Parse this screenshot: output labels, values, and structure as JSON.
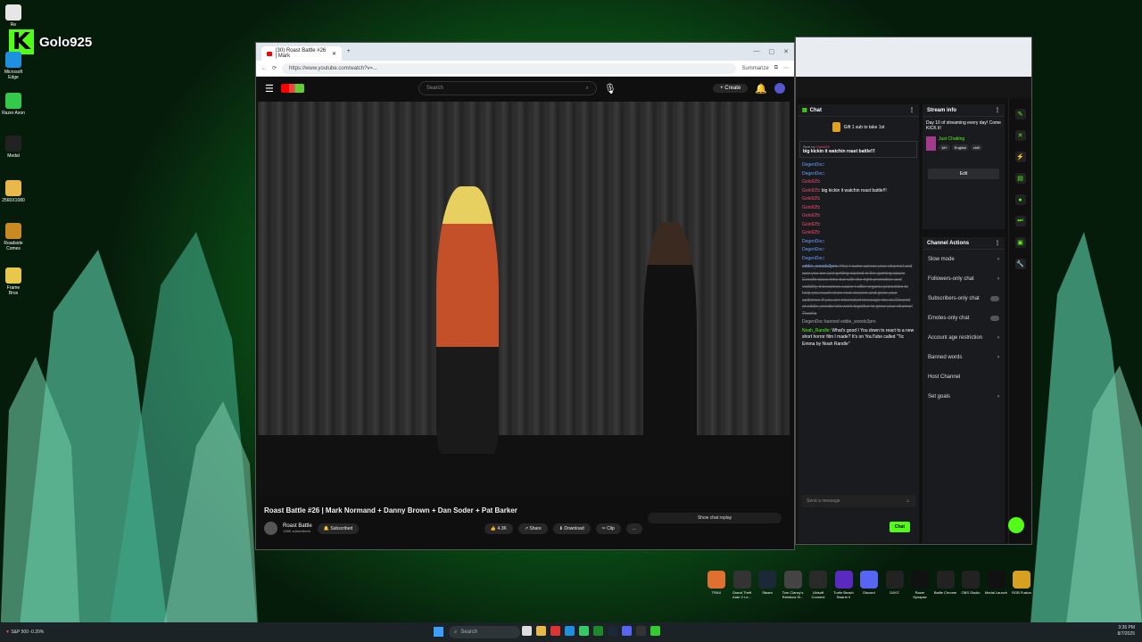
{
  "streamer": {
    "name": "Golo925",
    "logo_letter": "K"
  },
  "desktop_icons": [
    {
      "label": "Re",
      "color": "#e6e6e6"
    },
    {
      "label": "Microsoft Edge",
      "color": "#1f8fe0"
    },
    {
      "label": "Razer Axon",
      "color": "#34c94a"
    },
    {
      "label": "Medal",
      "color": "#222"
    },
    {
      "label": "2560X1080",
      "color": "#e8b84a"
    },
    {
      "label": "Roadside Comes",
      "color": "#c98a22"
    },
    {
      "label": "Frame Bros",
      "color": "#e8c84a"
    }
  ],
  "browser": {
    "tab_title": "(30) Roast Battle #26 | Mark",
    "url": "https://www.youtube.com/watch?v=...",
    "summarize": "Summarize",
    "search_placeholder": "Search",
    "create": "Create",
    "video_title": "Roast Battle #26 | Mark Normand + Danny Brown + Dan Soder + Pat Barker",
    "channel": "Roast Battle",
    "subs": "138K subscribers",
    "subscribed": "Subscribed",
    "likes": "4.3K",
    "share": "Share",
    "download": "Download",
    "clip": "Clip",
    "more": "...",
    "chat_replay": "Show chat replay"
  },
  "kick": {
    "chat_title": "Chat",
    "gift_banner": "Gift 1 sub to take 1st",
    "sent_by": "Sent by",
    "pinned_msg": "big kickin it watchin roast battle!!!",
    "chat_lines": [
      {
        "user": "DegenDoc",
        "text": "",
        "cls": "u-b"
      },
      {
        "user": "DegenDoc",
        "text": "",
        "cls": "u-b"
      },
      {
        "user": "Golo925",
        "text": "",
        "cls": "u-r"
      },
      {
        "user": "Golo925",
        "text": "big kickin it watchin roast battle!!!",
        "cls": "u-r"
      },
      {
        "user": "Golo925",
        "text": "",
        "cls": "u-r"
      },
      {
        "user": "Golo925",
        "text": "",
        "cls": "u-r"
      },
      {
        "user": "Golo925",
        "text": "",
        "cls": "u-r"
      },
      {
        "user": "Golo925",
        "text": "",
        "cls": "u-r"
      },
      {
        "user": "Golo925",
        "text": "",
        "cls": "u-r"
      },
      {
        "user": "DegenDoc",
        "text": "",
        "cls": "u-b"
      },
      {
        "user": "DegenDoc",
        "text": "",
        "cls": "u-b"
      },
      {
        "user": "DegenDoc",
        "text": "",
        "cls": "u-b"
      }
    ],
    "spam_user": "eddie_woods3pro",
    "spam_text": "Hey I came across your channel and saw you are just getting started in the gaming space Growth takes time but with the right promotion and visibility it becomes easier I offer organic promotion to help you reach more real viewers and grow your audience If you are interested message me on Discord at eddie_woods lets work together to grow your channel Thanks",
    "ban_line": "DegenDoc banned eddie_woods3pro",
    "noah_user": "Noah_Randle",
    "noah_text": "What's good I You down to react to a new short horror film I made? It's on YouTube called \"Tic Emma by Noah Randle\"",
    "send_placeholder": "Send a message",
    "chat_button": "Chat",
    "stream_info_title": "Stream info",
    "stream_title": "Day 10 of streaming every day! Come KICK it!",
    "category": "Just Chatting",
    "tags": [
      "18+",
      "English",
      "chill"
    ],
    "edit": "Edit",
    "channel_actions_title": "Channel Actions",
    "actions": [
      {
        "label": "Slow mode",
        "kind": "arrow"
      },
      {
        "label": "Followers-only chat",
        "kind": "arrow"
      },
      {
        "label": "Subscribers-only chat",
        "kind": "toggle"
      },
      {
        "label": "Emotes-only chat",
        "kind": "toggle"
      },
      {
        "label": "Account age restriction",
        "kind": "arrow"
      },
      {
        "label": "Banned words",
        "kind": "arrow"
      },
      {
        "label": "Host Channel",
        "kind": "none"
      },
      {
        "label": "Set goals",
        "kind": "arrow"
      }
    ]
  },
  "dock_icons": [
    {
      "label": "TRAX",
      "color": "#e07030"
    },
    {
      "label": "Grand Theft Auto V Le...",
      "color": "#333"
    },
    {
      "label": "Steam",
      "color": "#1b2838"
    },
    {
      "label": "Tom Clancy's Rainbow Si...",
      "color": "#444"
    },
    {
      "label": "Ubisoft Connect",
      "color": "#2a2a2a"
    },
    {
      "label": "Turtle Beach Swarm II",
      "color": "#5a2ac0"
    },
    {
      "label": "Discord",
      "color": "#5865f2"
    },
    {
      "label": "DAYZ",
      "color": "#222"
    },
    {
      "label": "Razer Synapse",
      "color": "#111"
    },
    {
      "label": "Battle Chrome",
      "color": "#222"
    },
    {
      "label": "OBS Studio",
      "color": "#222"
    },
    {
      "label": "Medal Launch",
      "color": "#111"
    },
    {
      "label": "RGB Fusion",
      "color": "#d8a020"
    }
  ],
  "taskbar": {
    "weather": "S&P 500 -0.20%",
    "search": "Search",
    "time": "3:36 PM",
    "date": "8/7/2025"
  }
}
